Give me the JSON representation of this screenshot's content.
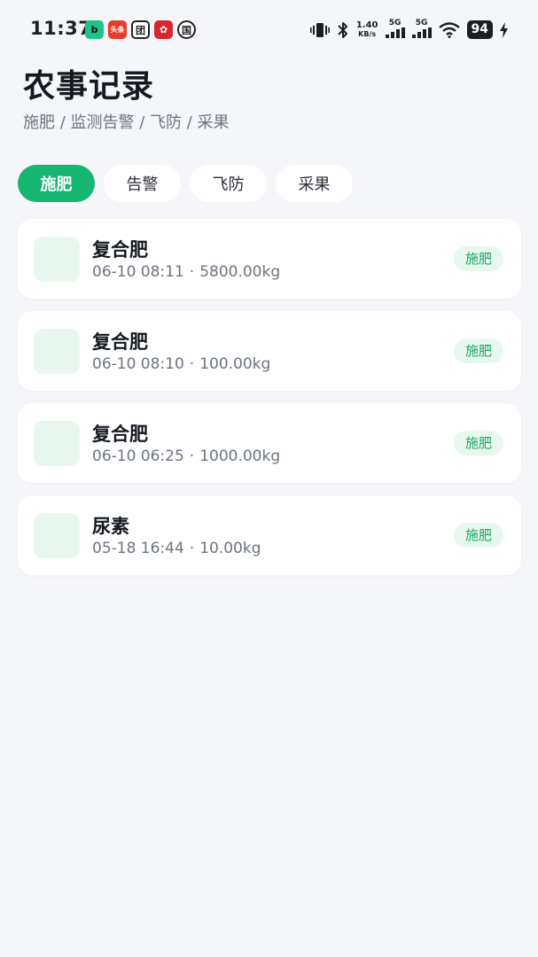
{
  "status_bar": {
    "time": "11:37",
    "app_icons": [
      "b",
      "头条",
      "团",
      "✿",
      "国"
    ],
    "network_speed": "1.40",
    "network_unit": "KB/s",
    "signal_1": "5G",
    "signal_2": "5G",
    "battery": "94"
  },
  "header": {
    "title": "农事记录",
    "subtitle": "施肥 / 监测告警 / 飞防 / 采果"
  },
  "filters": [
    {
      "label": "施肥",
      "active": true
    },
    {
      "label": "告警",
      "active": false
    },
    {
      "label": "飞防",
      "active": false
    },
    {
      "label": "采果",
      "active": false
    }
  ],
  "records": [
    {
      "name": "复合肥",
      "time": "06-10 08:11",
      "amount": "5800.00kg",
      "tag": "施肥"
    },
    {
      "name": "复合肥",
      "time": "06-10 08:10",
      "amount": "100.00kg",
      "tag": "施肥"
    },
    {
      "name": "复合肥",
      "time": "06-10 06:25",
      "amount": "1000.00kg",
      "tag": "施肥"
    },
    {
      "name": "尿素",
      "time": "05-18 16:44",
      "amount": "10.00kg",
      "tag": "施肥"
    }
  ],
  "meta_separator": "·",
  "colors": {
    "accent": "#17b572",
    "tag_bg": "#e9f8ef",
    "tag_text": "#17a465",
    "background": "#f5f6fa"
  }
}
